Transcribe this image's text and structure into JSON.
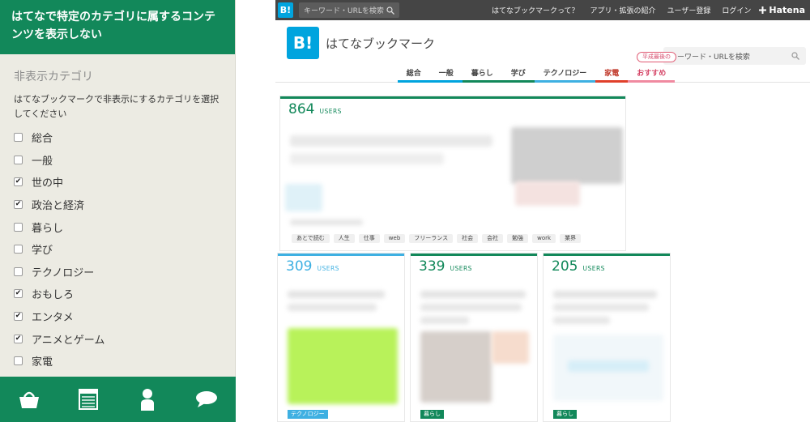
{
  "panel": {
    "title": "はてなで特定のカテゴリに属するコンテンツを表示しない",
    "subtitle": "非表示カテゴリ",
    "description": "はてなブックマークで非表示にするカテゴリを選択してください",
    "categories": [
      {
        "label": "総合",
        "checked": false
      },
      {
        "label": "一般",
        "checked": false
      },
      {
        "label": "世の中",
        "checked": true
      },
      {
        "label": "政治と経済",
        "checked": true
      },
      {
        "label": "暮らし",
        "checked": false
      },
      {
        "label": "学び",
        "checked": false
      },
      {
        "label": "テクノロジー",
        "checked": false
      },
      {
        "label": "おもしろ",
        "checked": true
      },
      {
        "label": "エンタメ",
        "checked": true
      },
      {
        "label": "アニメとゲーム",
        "checked": true
      },
      {
        "label": "家電",
        "checked": false
      }
    ],
    "nav_icons": [
      "basket-icon",
      "list-icon",
      "person-icon",
      "speech-bubble-icon"
    ]
  },
  "site": {
    "topbar": {
      "logo": "B!",
      "search_placeholder": "キーワード・URLを検索",
      "links": [
        "はてなブックマークって？",
        "アプリ・拡張の紹介",
        "ユーザー登録",
        "ログイン"
      ],
      "brand": "Hatena"
    },
    "header": {
      "logo": "B!",
      "title": "はてなブックマーク",
      "search_placeholder": "キーワード・URLを検索"
    },
    "tabs": [
      {
        "label": "総合",
        "color": "#00a4de"
      },
      {
        "label": "一般",
        "color": "#00a4de"
      },
      {
        "label": "暮らし",
        "color": "#12885a"
      },
      {
        "label": "学び",
        "color": "#12885a"
      },
      {
        "label": "テクノロジー",
        "color": "#3eb0e2"
      },
      {
        "label": "家電",
        "color": "#e0402b"
      },
      {
        "label": "おすすめ",
        "color": "#f08aa0"
      }
    ],
    "badge": "平成最後の",
    "cards": [
      {
        "count": "864",
        "unit": "USERS",
        "color": "#12885a"
      },
      {
        "count": "309",
        "unit": "USERS",
        "color": "#3eb0e2"
      },
      {
        "count": "339",
        "unit": "USERS",
        "color": "#12885a"
      },
      {
        "count": "205",
        "unit": "USERS",
        "color": "#12885a"
      }
    ],
    "tags": [
      "あとで読む",
      "人生",
      "仕事",
      "web",
      "フリーランス",
      "社会",
      "会社",
      "勉強",
      "work",
      "業界"
    ],
    "card_categories": [
      {
        "label": "テクノロジー",
        "color": "#3eb0e2"
      },
      {
        "label": "暮らし",
        "color": "#12885a"
      },
      {
        "label": "暮らし",
        "color": "#12885a"
      }
    ]
  }
}
